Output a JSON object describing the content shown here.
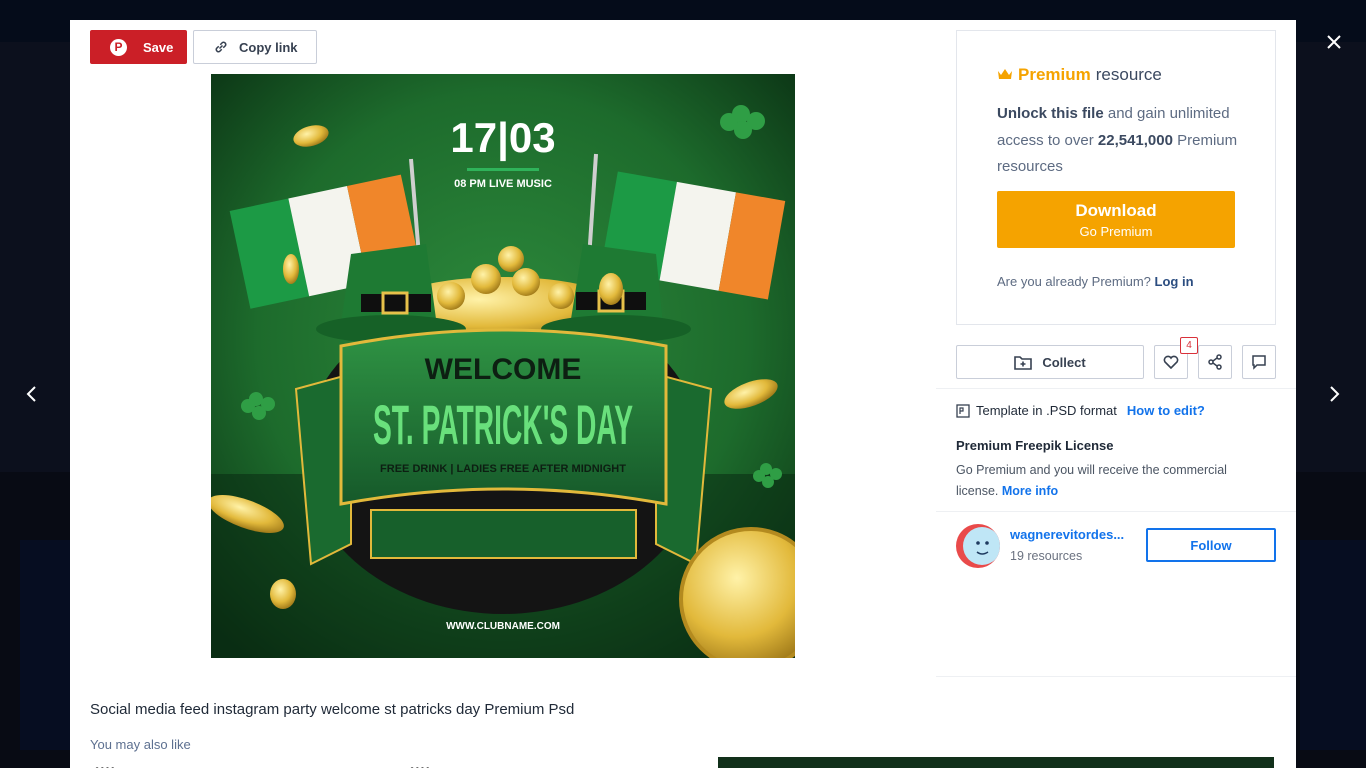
{
  "toolbar": {
    "save_label": "Save",
    "copy_link_label": "Copy link"
  },
  "poster": {
    "date": "17|03",
    "subtitle": "08 PM LIVE MUSIC",
    "welcome": "WELCOME",
    "headline": "ST. PATRICK'S DAY",
    "tagline": "FREE DRINK | LADIES FREE AFTER MIDNIGHT",
    "website": "WWW.CLUBNAME.COM"
  },
  "item": {
    "title": "Social media feed instagram party welcome st patricks day Premium Psd",
    "may_also_like": "You may also like",
    "dots1": "••••",
    "dots2": "••••"
  },
  "premium": {
    "word_premium": "Premium",
    "word_resource": "resource",
    "unlock_bold": "Unlock this file",
    "unlock_rest": "and gain unlimited access to over",
    "count": "22,541,000",
    "count_suffix": "Premium resources",
    "download_label": "Download",
    "download_sub": "Go Premium",
    "already_text": "Are you already Premium?",
    "login_label": "Log in"
  },
  "actions": {
    "collect_label": "Collect",
    "likes_count": "4"
  },
  "info": {
    "template_text": "Template in .PSD format",
    "how_to_edit": "How to edit?",
    "license_title": "Premium Freepik License",
    "license_text": "Go Premium and you will receive the commercial license.",
    "more_info": "More info"
  },
  "author": {
    "name": "wagnerevitordes...",
    "resources": "19 resources",
    "follow_label": "Follow"
  },
  "navigation": {
    "prev_icon": "chevron-left-icon",
    "next_icon": "chevron-right-icon",
    "close_icon": "close-icon"
  },
  "colors": {
    "save_red": "#cb1f27",
    "premium_orange": "#f5a300",
    "link_blue": "#1273eb",
    "poster_green": "#1d6b2c"
  }
}
